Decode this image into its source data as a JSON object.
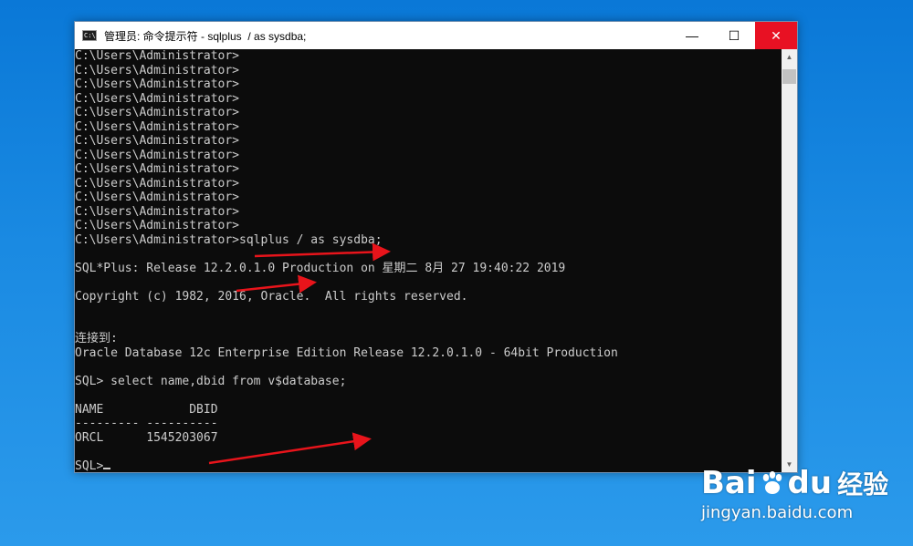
{
  "window": {
    "title": "管理员: 命令提示符 - sqlplus  / as sysdba;",
    "app_icon_text": "C:\\",
    "minimize_glyph": "—",
    "maximize_glyph": "☐",
    "close_glyph": "✕"
  },
  "terminal": {
    "lines": [
      "C:\\Users\\Administrator>",
      "C:\\Users\\Administrator>",
      "C:\\Users\\Administrator>",
      "C:\\Users\\Administrator>",
      "C:\\Users\\Administrator>",
      "C:\\Users\\Administrator>",
      "C:\\Users\\Administrator>",
      "C:\\Users\\Administrator>",
      "C:\\Users\\Administrator>",
      "C:\\Users\\Administrator>",
      "C:\\Users\\Administrator>",
      "C:\\Users\\Administrator>",
      "C:\\Users\\Administrator>",
      "C:\\Users\\Administrator>sqlplus / as sysdba;",
      "",
      "SQL*Plus: Release 12.2.0.1.0 Production on 星期二 8月 27 19:40:22 2019",
      "",
      "Copyright (c) 1982, 2016, Oracle.  All rights reserved.",
      "",
      "",
      "连接到:",
      "Oracle Database 12c Enterprise Edition Release 12.2.0.1.0 - 64bit Production",
      "",
      "SQL> select name,dbid from v$database;",
      "",
      "NAME            DBID",
      "--------- ----------",
      "ORCL      1545203067",
      "",
      "SQL>"
    ]
  },
  "scrollbar": {
    "up_glyph": "▲",
    "down_glyph": "▼"
  },
  "annotations": {
    "arrow_color": "#e8141b"
  },
  "watermark": {
    "logo_left": "Bai",
    "logo_right": "du",
    "logo_cn": "经验",
    "url": "jingyan.baidu.com"
  }
}
